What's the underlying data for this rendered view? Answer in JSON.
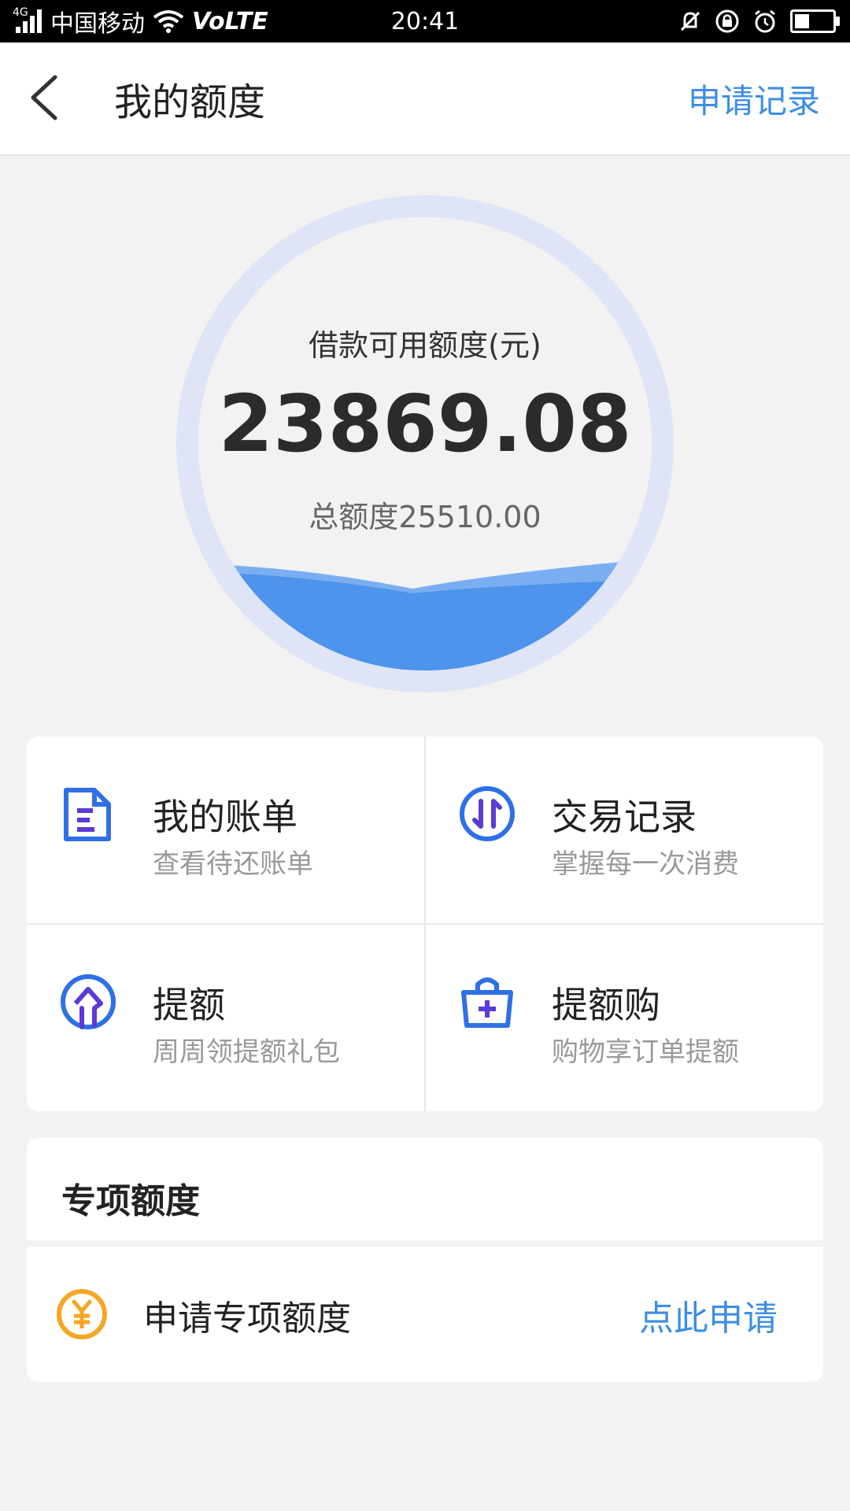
{
  "status_bar": {
    "network_type": "4G",
    "carrier": "中国移动",
    "volte": "VoLTE",
    "time": "20:41"
  },
  "header": {
    "title": "我的额度",
    "apply_record": "申请记录"
  },
  "credit": {
    "available_label": "借款可用额度(元)",
    "available_amount": "23869.08",
    "total_label": "总额度25510.00"
  },
  "features": [
    {
      "title": "我的账单",
      "subtitle": "查看待还账单",
      "icon": "bill-icon"
    },
    {
      "title": "交易记录",
      "subtitle": "掌握每一次消费",
      "icon": "transaction-icon"
    },
    {
      "title": "提额",
      "subtitle": "周周领提额礼包",
      "icon": "raise-limit-icon"
    },
    {
      "title": "提额购",
      "subtitle": "购物享订单提额",
      "icon": "shopping-bag-plus-icon"
    }
  ],
  "special": {
    "title": "专项额度",
    "apply_label": "申请专项额度",
    "apply_action": "点此申请",
    "icon": "yuan-coin-icon"
  },
  "colors": {
    "accent_blue": "#3d8ee4",
    "icon_blue": "#2f6fe8",
    "icon_purple": "#5b3ad6",
    "wave_blue": "#4e93ec",
    "ring": "#dfe4f6",
    "coin_orange": "#f5a623",
    "background": "#f2f2f2"
  }
}
